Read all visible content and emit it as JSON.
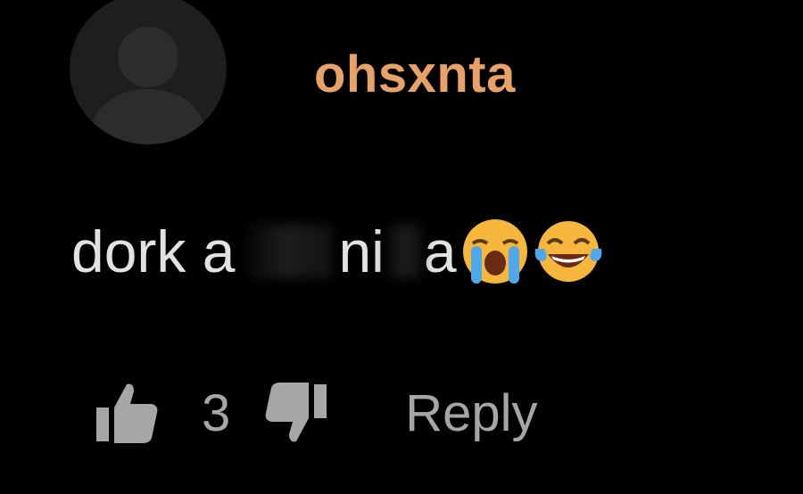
{
  "comment": {
    "username": "ohsxnta",
    "text_before": "dork a",
    "text_after": "ni",
    "text_tail": "a",
    "emojis": [
      "loudly-crying-face-icon",
      "tears-of-joy-icon"
    ],
    "like_count": "3",
    "reply_label": "Reply"
  },
  "colors": {
    "background": "#000000",
    "username": "#e8a267",
    "text": "#e2e2e2",
    "muted": "#a6a6a6"
  },
  "icons": {
    "avatar": "default-avatar-icon",
    "like": "thumbs-up-icon",
    "dislike": "thumbs-down-icon"
  }
}
